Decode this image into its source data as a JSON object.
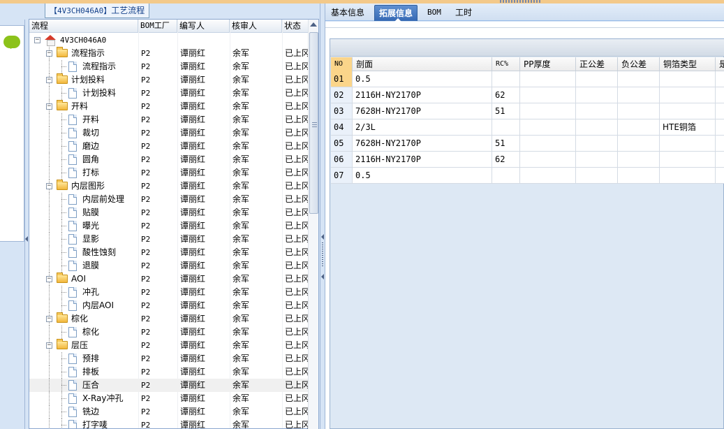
{
  "left": {
    "title_code": "【4V3CH046A0】",
    "title_text": "工艺流程",
    "columns": [
      "流程",
      "BOM工厂",
      "编写人",
      "核审人",
      "状态"
    ],
    "root": "4V3CH046A0",
    "rows": [
      {
        "label": "流程指示",
        "type": "folder",
        "bom": "P2",
        "writer": "谭丽红",
        "reviewer": "余军",
        "status": "已上冈"
      },
      {
        "label": "流程指示",
        "type": "doc",
        "bom": "P2",
        "writer": "谭丽红",
        "reviewer": "余军",
        "status": "已上冈"
      },
      {
        "label": "计划投料",
        "type": "folder",
        "bom": "P2",
        "writer": "谭丽红",
        "reviewer": "余军",
        "status": "已上冈"
      },
      {
        "label": "计划投料",
        "type": "doc",
        "bom": "P2",
        "writer": "谭丽红",
        "reviewer": "余军",
        "status": "已上冈"
      },
      {
        "label": "开料",
        "type": "folder",
        "bom": "P2",
        "writer": "谭丽红",
        "reviewer": "余军",
        "status": "已上冈"
      },
      {
        "label": "开料",
        "type": "doc",
        "bom": "P2",
        "writer": "谭丽红",
        "reviewer": "余军",
        "status": "已上冈"
      },
      {
        "label": "裁切",
        "type": "doc",
        "bom": "P2",
        "writer": "谭丽红",
        "reviewer": "余军",
        "status": "已上冈"
      },
      {
        "label": "磨边",
        "type": "doc",
        "bom": "P2",
        "writer": "谭丽红",
        "reviewer": "余军",
        "status": "已上冈"
      },
      {
        "label": "圆角",
        "type": "doc",
        "bom": "P2",
        "writer": "谭丽红",
        "reviewer": "余军",
        "status": "已上冈"
      },
      {
        "label": "打标",
        "type": "doc",
        "bom": "P2",
        "writer": "谭丽红",
        "reviewer": "余军",
        "status": "已上冈"
      },
      {
        "label": "内层图形",
        "type": "folder",
        "bom": "P2",
        "writer": "谭丽红",
        "reviewer": "余军",
        "status": "已上冈"
      },
      {
        "label": "内层前处理",
        "type": "doc",
        "bom": "P2",
        "writer": "谭丽红",
        "reviewer": "余军",
        "status": "已上冈"
      },
      {
        "label": "贴膜",
        "type": "doc",
        "bom": "P2",
        "writer": "谭丽红",
        "reviewer": "余军",
        "status": "已上冈"
      },
      {
        "label": "曝光",
        "type": "doc",
        "bom": "P2",
        "writer": "谭丽红",
        "reviewer": "余军",
        "status": "已上冈"
      },
      {
        "label": "显影",
        "type": "doc",
        "bom": "P2",
        "writer": "谭丽红",
        "reviewer": "余军",
        "status": "已上冈"
      },
      {
        "label": "酸性蚀刻",
        "type": "doc",
        "bom": "P2",
        "writer": "谭丽红",
        "reviewer": "余军",
        "status": "已上冈"
      },
      {
        "label": "退膜",
        "type": "doc",
        "bom": "P2",
        "writer": "谭丽红",
        "reviewer": "余军",
        "status": "已上冈"
      },
      {
        "label": "AOI",
        "type": "folder",
        "bom": "P2",
        "writer": "谭丽红",
        "reviewer": "余军",
        "status": "已上冈"
      },
      {
        "label": "冲孔",
        "type": "doc",
        "bom": "P2",
        "writer": "谭丽红",
        "reviewer": "余军",
        "status": "已上冈"
      },
      {
        "label": "内层AOI",
        "type": "doc",
        "bom": "P2",
        "writer": "谭丽红",
        "reviewer": "余军",
        "status": "已上冈"
      },
      {
        "label": "棕化",
        "type": "folder",
        "bom": "P2",
        "writer": "谭丽红",
        "reviewer": "余军",
        "status": "已上冈"
      },
      {
        "label": "棕化",
        "type": "doc",
        "bom": "P2",
        "writer": "谭丽红",
        "reviewer": "余军",
        "status": "已上冈"
      },
      {
        "label": "层压",
        "type": "folder",
        "bom": "P2",
        "writer": "谭丽红",
        "reviewer": "余军",
        "status": "已上冈"
      },
      {
        "label": "预排",
        "type": "doc",
        "bom": "P2",
        "writer": "谭丽红",
        "reviewer": "余军",
        "status": "已上冈"
      },
      {
        "label": "排板",
        "type": "doc",
        "bom": "P2",
        "writer": "谭丽红",
        "reviewer": "余军",
        "status": "已上冈"
      },
      {
        "label": "压合",
        "type": "doc",
        "bom": "P2",
        "writer": "谭丽红",
        "reviewer": "余军",
        "status": "已上冈",
        "selected": true
      },
      {
        "label": "X-Ray冲孔",
        "type": "doc",
        "bom": "P2",
        "writer": "谭丽红",
        "reviewer": "余军",
        "status": "已上冈"
      },
      {
        "label": "铣边",
        "type": "doc",
        "bom": "P2",
        "writer": "谭丽红",
        "reviewer": "余军",
        "status": "已上冈"
      },
      {
        "label": "打字唛",
        "type": "doc",
        "bom": "P2",
        "writer": "谭丽红",
        "reviewer": "余军",
        "status": "已上冈"
      }
    ]
  },
  "right": {
    "tabs": [
      "基本信息",
      "拓展信息",
      "BOM",
      "工时"
    ],
    "active_tab": 1,
    "columns": [
      "NO",
      "剖面",
      "RC%",
      "PP厚度",
      "正公差",
      "负公差",
      "铜箔类型",
      "是"
    ],
    "rows": [
      {
        "no": "01",
        "section": "0.5",
        "rc": "",
        "pp": "",
        "pos": "",
        "neg": "",
        "copper": ""
      },
      {
        "no": "02",
        "section": "2116H-NY2170P",
        "rc": "62",
        "pp": "",
        "pos": "",
        "neg": "",
        "copper": ""
      },
      {
        "no": "03",
        "section": "7628H-NY2170P",
        "rc": "51",
        "pp": "",
        "pos": "",
        "neg": "",
        "copper": ""
      },
      {
        "no": "04",
        "section": "2/3L",
        "rc": "",
        "pp": "",
        "pos": "",
        "neg": "",
        "copper": "HTE铜箔"
      },
      {
        "no": "05",
        "section": "7628H-NY2170P",
        "rc": "51",
        "pp": "",
        "pos": "",
        "neg": "",
        "copper": ""
      },
      {
        "no": "06",
        "section": "2116H-NY2170P",
        "rc": "62",
        "pp": "",
        "pos": "",
        "neg": "",
        "copper": ""
      },
      {
        "no": "07",
        "section": "0.5",
        "rc": "",
        "pp": "",
        "pos": "",
        "neg": "",
        "copper": ""
      }
    ]
  },
  "colors": {
    "accent": "#3569b4",
    "panel_bg": "#d6e4f5",
    "header_highlight": "#fbd58a",
    "folder": "#f2b73c"
  }
}
